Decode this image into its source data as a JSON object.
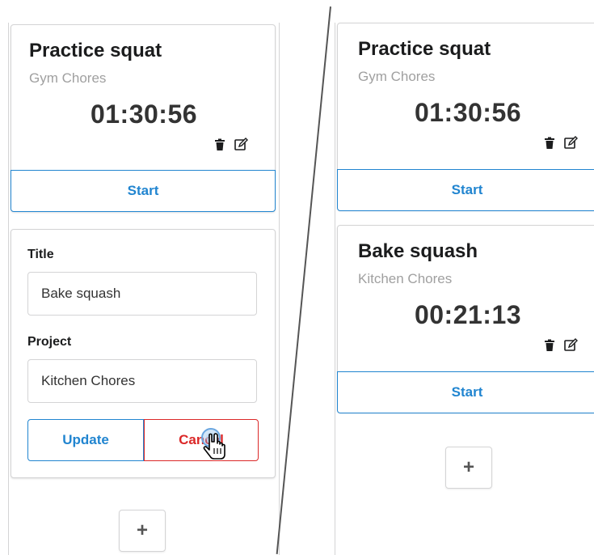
{
  "left_panel": {
    "timer": {
      "title": "Practice squat",
      "project": "Gym Chores",
      "elapsed": "01:30:56",
      "start_label": "Start",
      "icons": [
        "trash-icon",
        "edit-icon"
      ]
    },
    "edit_form": {
      "title_label": "Title",
      "title_value": "Bake squash",
      "project_label": "Project",
      "project_value": "Kitchen Chores",
      "update_label": "Update",
      "cancel_label": "Cancel"
    },
    "add_label": "+"
  },
  "right_panel": {
    "timers": [
      {
        "title": "Practice squat",
        "project": "Gym Chores",
        "elapsed": "01:30:56",
        "start_label": "Start"
      },
      {
        "title": "Bake squash",
        "project": "Kitchen Chores",
        "elapsed": "00:21:13",
        "start_label": "Start"
      }
    ],
    "add_label": "+"
  },
  "colors": {
    "primary": "#2185d0",
    "danger": "#db2828",
    "muted_text": "#a0a0a0"
  }
}
